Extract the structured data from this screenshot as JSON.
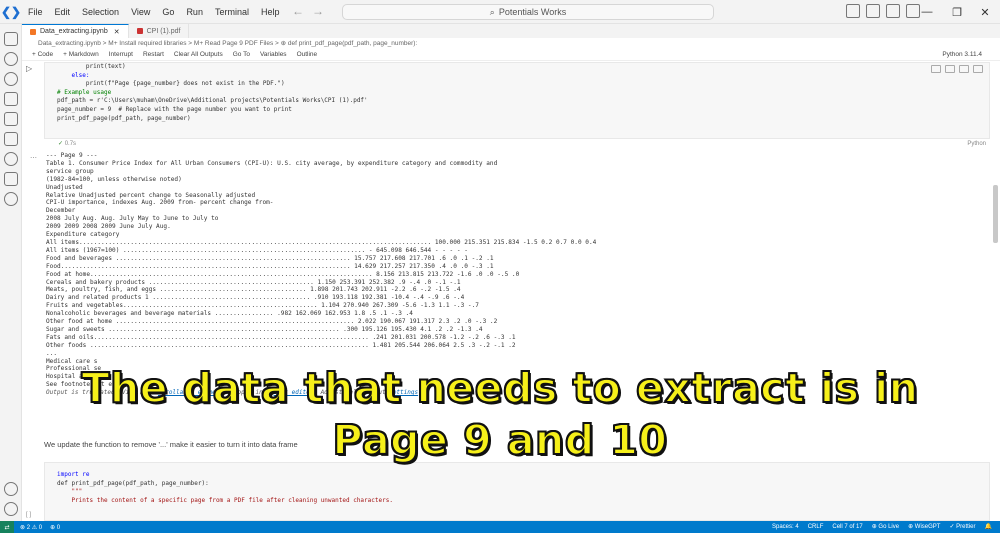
{
  "menu": [
    "File",
    "Edit",
    "Selection",
    "View",
    "Go",
    "Run",
    "Terminal",
    "Help"
  ],
  "search": {
    "text": "Potentials Works"
  },
  "tabs": [
    {
      "label": "Data_extracting.ipynb",
      "active": true
    },
    {
      "label": "CPI (1).pdf",
      "active": false
    }
  ],
  "breadcrumb": "Data_extracting.ipynb > M+ Install required libraries > M+ Read Page 9 PDF Files > ⊕ def print_pdf_page(pdf_path, page_number):",
  "toolbar": {
    "code": "+ Code",
    "markdown": "+ Markdown",
    "interrupt": "Interrupt",
    "restart": "Restart",
    "clear": "Clear All Outputs",
    "goto": "Go To",
    "variables": "Variables",
    "outline": "Outline",
    "kernel": "Python 3.11.4"
  },
  "cell1": {
    "lines": [
      "        print(text)",
      "    else:",
      "        print(f\"Page {page_number} does not exist in the PDF.\")",
      "",
      "# Example usage",
      "pdf_path = r'C:\\Users\\muham\\OneDrive\\Additional projects\\Potentials Works\\CPI (1).pdf'",
      "page_number = 9  # Replace with the page number you want to print",
      "print_pdf_page(pdf_path, page_number)"
    ],
    "status": "0.7s",
    "language": "Python"
  },
  "output": {
    "lines": [
      "--- Page 9 ---",
      "Table 1. Consumer Price Index for All Urban Consumers (CPI-U): U.S. city average, by expenditure category and commodity and",
      "service group",
      "(1982-84=100, unless otherwise noted)",
      "Unadjusted",
      "Relative Unadjusted percent change to Seasonally adjusted",
      "CPI-U importance, indexes Aug. 2009 from- percent change from-",
      "December",
      "2008 July Aug. Aug. July May to June to July to",
      "2009 2009 2008 2009 June July Aug.",
      "Expenditure category",
      "All items................................................................................................ 100.000 215.351 215.834 -1.5 0.2 0.7 0.0 0.4",
      "All items (1967=100) .................................................................. - 645.098 646.544 - - - - -",
      "Food and beverages ................................................................ 15.757 217.608 217.701 .6 .0 .1 -.2 .1",
      "Food............................................................................... 14.629 217.257 217.350 .4 .0 .0 -.3 .1",
      "Food at home............................................................................. 8.156 213.815 213.722 -1.6 .0 .0 -.5 .0",
      "Cereals and bakery products ............................................. 1.150 253.391 252.382 .9 -.4 .0 -.1 -.1",
      "Meats, poultry, fish, and eggs ........................................ 1.898 201.743 202.911 -2.2 .6 -.2 -1.5 .4",
      "Dairy and related products 1 ........................................... .910 193.118 192.381 -10.4 -.4 -.9 .6 -.4",
      "Fruits and vegetables..................................................... 1.104 270.940 267.309 -5.6 -1.3 1.1 -.3 -.7",
      "Nonalcoholic beverages and beverage materials ................ .982 162.069 162.953 1.8 .5 .1 -.3 .4",
      "Other food at home ................................................................. 2.022 190.067 191.317 2.3 .2 .0 -.3 .2",
      "Sugar and sweets ............................................................... .300 195.126 195.430 4.1 .2 .2 -1.3 .4",
      "Fats and oils........................................................................... .241 201.031 200.578 -1.2 -.2 .6 -.3 .1",
      "Other foods ............................................................................ 1.481 205.544 206.064 2.5 .3 -.2 -.1 .2",
      "...",
      "Medical care s",
      "Professional se",
      "Hospital and rela",
      "See footnotes at e"
    ],
    "note_prefix": "Output is truncated. View as a ",
    "note_link1": "scrollable element",
    "note_middle": " or open in a ",
    "note_link2": "text editor",
    "note_suffix": ". Adjust cell output ",
    "note_link3": "settings",
    "note_end": "..."
  },
  "markdown_text": "We update the function to remove '...' make it easier to turn it into data frame",
  "cell2": {
    "lines": [
      "import re",
      "",
      "def print_pdf_page(pdf_path, page_number):",
      "    \"\"\"",
      "    Prints the content of a specific page from a PDF file after cleaning unwanted characters."
    ],
    "number": "[ ]"
  },
  "caption": {
    "line1": "The data that needs to extract is in",
    "line2": "Page 9 and 10"
  },
  "status": {
    "errors": "⊗ 2 ⚠ 0",
    "ports": "⊕ 0",
    "spaces": "Spaces: 4",
    "eol": "CRLF",
    "cell": "Cell 7 of 17",
    "golive": "⊕ Go Live",
    "wisegpt": "⊕ WiseGPT",
    "prettier": "✓ Prettier"
  },
  "colors": {
    "accent": "#007acc",
    "caption": "#f6f01a"
  }
}
